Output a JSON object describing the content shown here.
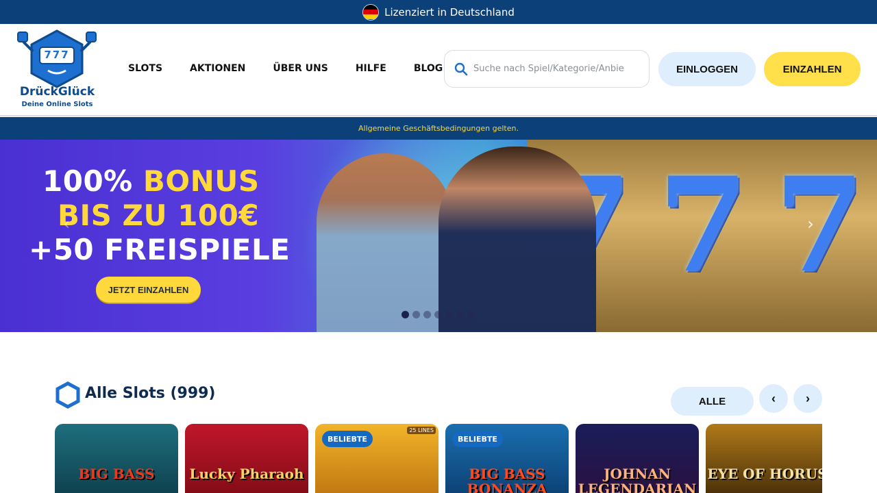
{
  "license_bar": {
    "text": "Lizenziert in Deutschland",
    "flag_colors": [
      "#000000",
      "#dd0000",
      "#ffce00"
    ]
  },
  "header": {
    "brand_name": "DrückGlück",
    "brand_tagline": "Deine Online Slots",
    "logo_digits": "777",
    "nav": [
      "SLOTS",
      "AKTIONEN",
      "ÜBER UNS",
      "HILFE",
      "BLOG"
    ],
    "search_placeholder": "Suche nach Spiel/Kategorie/Anbieter",
    "login_label": "EINLOGGEN",
    "deposit_label": "EINZAHLEN"
  },
  "terms_text": "Allgemeine Geschäftsbedingungen gelten.",
  "hero": {
    "line1_white": "100% ",
    "line1_yellow": "BONUS",
    "line2": "BIS ZU 100€",
    "line3": "+50 FREISPIELE",
    "cta": "JETZT EINZAHLEN",
    "reel_symbol": "7",
    "slide_count": 7,
    "active_slide": 1
  },
  "section": {
    "title": "Alle Slots (999)",
    "filter_label": "ALLE",
    "prev_icon": "‹",
    "next_icon": "›"
  },
  "games": [
    {
      "title": "BIG BASS",
      "badge": "",
      "colors": [
        "#1e6e7e",
        "#0d3a46"
      ],
      "title_color": "#e83a1f"
    },
    {
      "title": "Lucky Pharaoh",
      "badge": "",
      "colors": [
        "#c0172a",
        "#7a0a14"
      ],
      "title_color": "#ffd466"
    },
    {
      "title": "",
      "badge": "BELIEBTE",
      "lines": "25 LINES",
      "colors": [
        "#f2b42a",
        "#b86e0e"
      ],
      "title_color": "#ffffff"
    },
    {
      "title": "BIG BASS BONANZA",
      "badge": "BELIEBTE",
      "colors": [
        "#1a6fb0",
        "#0b3a6b"
      ],
      "title_color": "#ff4a20"
    },
    {
      "title": "JOHNAN LEGENDARIAN",
      "badge": "",
      "colors": [
        "#1a1d5a",
        "#2c0f3c"
      ],
      "title_color": "#ffb27a"
    },
    {
      "title": "EYE OF HORUS",
      "badge": "",
      "colors": [
        "#b07a1a",
        "#3a2406"
      ],
      "title_color": "#f3e2a8"
    }
  ]
}
